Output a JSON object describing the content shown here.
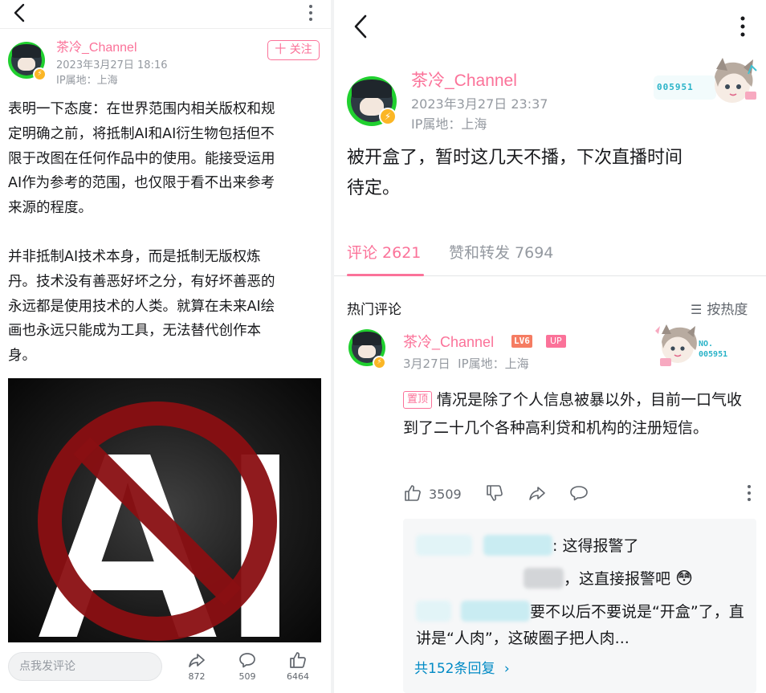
{
  "left": {
    "author": {
      "name": "茶冷_Channel",
      "date": "2023年3月27日 18:16",
      "ip": "IP属地：上海"
    },
    "follow_label": "十 关注",
    "body_paragraphs": [
      "表明一下态度：在世界范围内相关版权和规\n定明确之前，将抵制AI和AI衍生物包括但不\n限于改图在任何作品中的使用。能接受运用\nAI作为参考的范围，也仅限于看不出来参考\n来源的程度。",
      "并非抵制AI技术本身，而是抵制无版权炼\n丹。技术没有善恶好坏之分，有好坏善恶的\n永远都是使用技术的人类。就算在未来AI绘\n画也永远只能成为工具，无法替代创作本\n身。"
    ],
    "image_text": "AI",
    "bottom": {
      "comment_placeholder": "点我发评论",
      "share_count": "872",
      "comment_count": "509",
      "like_count": "6464"
    }
  },
  "right": {
    "author": {
      "name": "茶冷_Channel",
      "date": "2023年3月27日 23:37",
      "ip": "IP属地：上海"
    },
    "deco_label": "005951",
    "post_text": "被开盒了，暂时这几天不播，下次直播时间\n待定。",
    "tabs": {
      "comments": "评论 2621",
      "likes": "赞和转发 7694"
    },
    "hot_title": "热门评论",
    "sort_label": "按热度",
    "comment": {
      "name": "茶冷_Channel",
      "level": "LV6",
      "up_badge": "UP",
      "meta": "3月27日  IP属地：上海",
      "deco_label": "NO.\n005951",
      "pin": "置顶",
      "text": "情况是除了个人信息被暴以外，目前一口气收到了二十几个各种高利贷和机构的注册短信。",
      "like_count": "3509"
    },
    "replies": [
      {
        "text": ": 这得报警了"
      },
      {
        "text": "，这直接报警吧"
      },
      {
        "text": "要不以后不要说是“开盒”了，直讲是“人肉”，这破圈子把人肉..."
      }
    ],
    "reply_more": "共152条回复"
  },
  "colors": {
    "brand_pink": "#fb7299",
    "gray": "#9499a0",
    "link_blue": "#008ac5"
  }
}
